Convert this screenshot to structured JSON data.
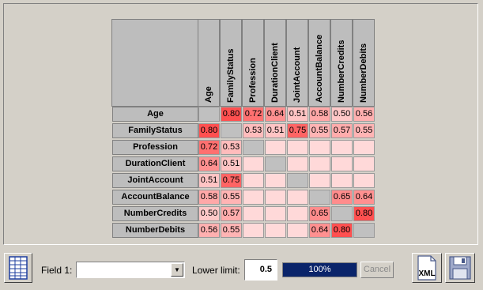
{
  "matrix": {
    "fields": [
      "Age",
      "FamilyStatus",
      "Profession",
      "DurationClient",
      "JointAccount",
      "AccountBalance",
      "NumberCredits",
      "NumberDebits"
    ],
    "values": [
      [
        null,
        "0.80",
        "0.72",
        "0.64",
        "0.51",
        "0.58",
        "0.50",
        "0.56"
      ],
      [
        "0.80",
        null,
        "0.53",
        "0.51",
        "0.75",
        "0.55",
        "0.57",
        "0.55"
      ],
      [
        "0.72",
        "0.53",
        null,
        "",
        "",
        "",
        "",
        ""
      ],
      [
        "0.64",
        "0.51",
        "",
        null,
        "",
        "",
        "",
        ""
      ],
      [
        "0.51",
        "0.75",
        "",
        "",
        null,
        "",
        "",
        ""
      ],
      [
        "0.58",
        "0.55",
        "",
        "",
        "",
        null,
        "0.65",
        "0.64"
      ],
      [
        "0.50",
        "0.57",
        "",
        "",
        "",
        "0.65",
        null,
        "0.80"
      ],
      [
        "0.56",
        "0.55",
        "",
        "",
        "",
        "0.64",
        "0.80",
        null
      ]
    ]
  },
  "controls": {
    "field1_label": "Field 1:",
    "field1_value": "",
    "lower_limit_label": "Lower limit:",
    "lower_limit_value": "0.5",
    "progress_percent": 100,
    "progress_text": "100%",
    "cancel_label": "Cancel",
    "xml_label": "XML"
  },
  "colors": {
    "progress_fill": "#0a246a",
    "diag": "#c0c0c0",
    "empty": "#ffd9d9"
  }
}
